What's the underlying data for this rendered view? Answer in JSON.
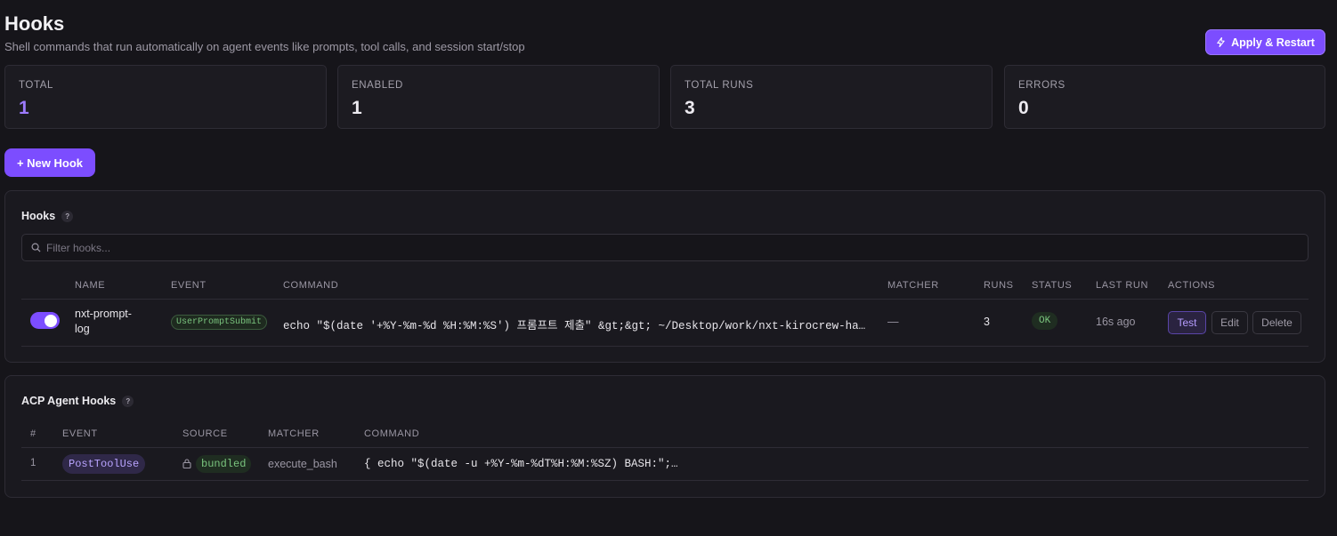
{
  "header": {
    "title": "Hooks",
    "subtitle": "Shell commands that run automatically on agent events like prompts, tool calls, and session start/stop",
    "apply_label": "Apply & Restart"
  },
  "stats": [
    {
      "label": "TOTAL",
      "value": "1"
    },
    {
      "label": "ENABLED",
      "value": "1"
    },
    {
      "label": "TOTAL RUNS",
      "value": "3"
    },
    {
      "label": "ERRORS",
      "value": "0"
    }
  ],
  "new_hook_label": "+ New Hook",
  "hooks_panel": {
    "title": "Hooks",
    "help": "?",
    "filter_placeholder": "Filter hooks...",
    "columns": [
      "NAME",
      "EVENT",
      "COMMAND",
      "MATCHER",
      "RUNS",
      "STATUS",
      "LAST RUN",
      "ACTIONS"
    ],
    "rows": [
      {
        "enabled": true,
        "name_line1": "nxt-prompt-",
        "name_line2": "log",
        "event": "UserPromptSubmit",
        "command": "echo \"$(date '+%Y-%m-%d %H:%M:%S') 프롬프트 제출\" &gt;&gt; ~/Desktop/work/nxt-kirocrew-ha…",
        "matcher": "—",
        "runs": "3",
        "status": "OK",
        "last_run": "16s ago",
        "actions": {
          "test": "Test",
          "edit": "Edit",
          "delete": "Delete"
        }
      }
    ]
  },
  "acp_panel": {
    "title": "ACP Agent Hooks",
    "help": "?",
    "columns": [
      "#",
      "EVENT",
      "SOURCE",
      "MATCHER",
      "COMMAND"
    ],
    "rows": [
      {
        "index": "1",
        "event": "PostToolUse",
        "source": "bundled",
        "matcher": "execute_bash",
        "command": "{ echo \"$(date -u +%Y-%m-%dT%H:%M:%SZ) BASH:\";…"
      }
    ]
  },
  "colors": {
    "accent": "#7c4dff",
    "background": "#16151a",
    "ok": "#7ac47e"
  }
}
